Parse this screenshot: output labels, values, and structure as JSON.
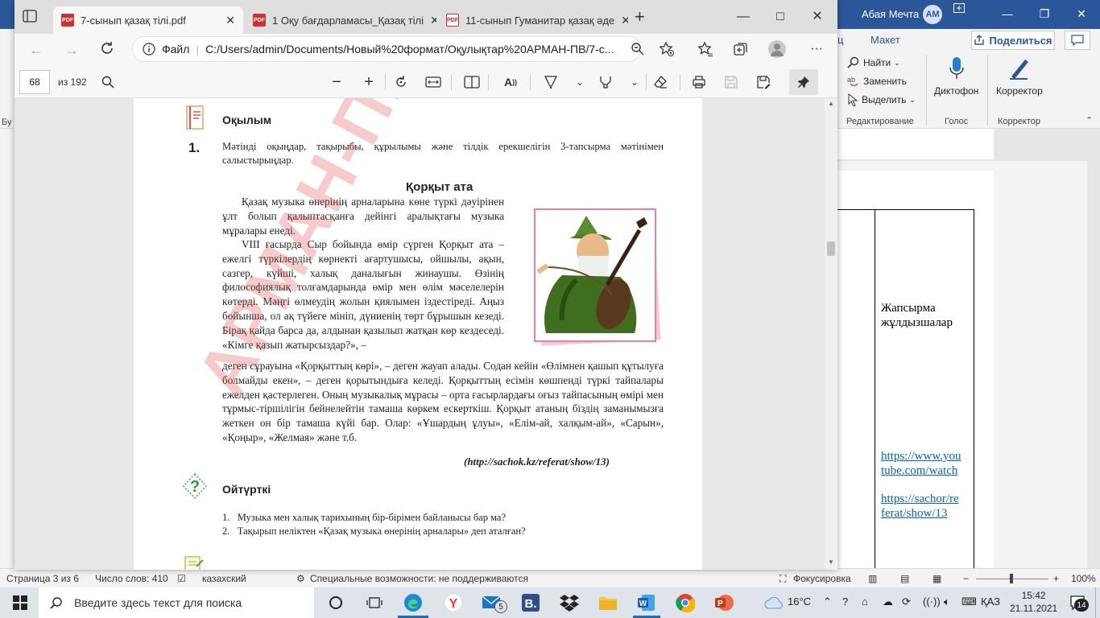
{
  "word": {
    "user_name": "Абая Мечта",
    "user_initials": "AM",
    "tab_partial": "ц",
    "tab_layout": "Макет",
    "share_label": "Поделиться",
    "find_label": "Найти",
    "replace_label": "Заменить",
    "select_label": "Выделить",
    "dictate_label": "Диктофон",
    "editor_label": "Корректор",
    "group_editing": "Редактирование",
    "group_voice": "Голос",
    "group_editor": "Корректор",
    "left_clip": "Бу",
    "cell_text": "Жапсырма жұлдызшалар",
    "link1_a": "https://www.you",
    "link1_b": "tube.com/watch",
    "link2_a": "https://sachor/re",
    "link2_b": "ferat/show/13"
  },
  "word_status": {
    "page": "Страница 3 из 6",
    "words": "Число слов: 410",
    "lang": "казахский",
    "accessibility": "Специальные возможности: не поддерживаются",
    "focus": "Фокусировка",
    "zoom": "100%"
  },
  "edge": {
    "tabs": [
      {
        "label": "7-сынып қазақ тілі.pdf"
      },
      {
        "label": "1 Оқу бағдарламасы_Қазақ тілі"
      },
      {
        "label": "11-сынып Гуманитар қазақ әде"
      }
    ],
    "file_label": "Файл",
    "url": "C:/Users/admin/Documents/Новый%20формат/Оқулықтар%20АРМАН-ПВ/7-с..."
  },
  "pdf_toolbar": {
    "page_number": "68",
    "total_pages": "из 192"
  },
  "pdf_page": {
    "section_reading": "Оқылым",
    "task_number": "1.",
    "task_text": "Мәтінді оқыңдар, тақырыбы, құрылымы және тілдік ерекшелігін 3-тапсырма мәтінімен салыстырыңдар.",
    "article_title": "Қорқыт ата",
    "para1": "Қазақ музыка өнерінің арналарына көне түркі дәуірінен ұлт болып қалыптасқанға дейінгі аралықтағы музыка мұралары енеді.",
    "para2a": "VIII ғасырда Сыр бойында өмір сүрген Қорқыт ата – ежелгі түркілердің көрнекті ағартушысы, ойшылы, ақын, сазгер, күйші, халық даналығын жинаушы. Өзінің философиялық толғамдарында өмір мен өлім мәселелерін көтерді. Мәңгі өлмеудің жолын қиялымен іздестіреді. Аңыз бойынша, ол ақ түйеге мініп, дүниенің төрт бұрышын кезеді. Бірақ қайда барса да, алдынан қазылып жатқан көр кездеседі. «Кімге қазып жатырсыздар?», –",
    "para2b": "деген сұрауына «Қорқыттың көрі», – деген жауап алады. Содан кейін «Өлімнен қашып құтылуға болмайды екен», – деген қорытындыға келеді. Қорқыттың есімін көшпенді түркі тайпалары ежелден қастерлеген. Оның музыкалық мұрасы – орта ғасырлардағы оғыз тайпасының өмірі мен тұрмыс-тіршілігін бейнелейтін тамаша көркем ескерткіш. Қорқыт атаның біздің заманымызға жеткен он бір тамаша күйі бар. Олар: «Ұшардың ұлуы», «Елім-ай, халқым-ай», «Сарын», «Қоңыр», «Желмая» және т.б.",
    "source": "(http://sachok.kz/referat/show/13)",
    "section_think": "Ойтүрткі",
    "questions": [
      {
        "num": "1.",
        "text": "Музыка мен халық тарихының бір-бірімен байланысы бар ма?"
      },
      {
        "num": "2.",
        "text": "Тақырып неліктен «Қазақ музыка өнерінің арналары» деп аталған?"
      }
    ],
    "watermark": "АРМАН-ПВ баспасы"
  },
  "taskbar": {
    "search_placeholder": "Введите здесь текст для поиска",
    "mail_badge": "5",
    "temperature": "16°C",
    "input_lang": "ҚАЗ",
    "time": "15:42",
    "date": "21.11.2021",
    "notif_count": "14"
  }
}
